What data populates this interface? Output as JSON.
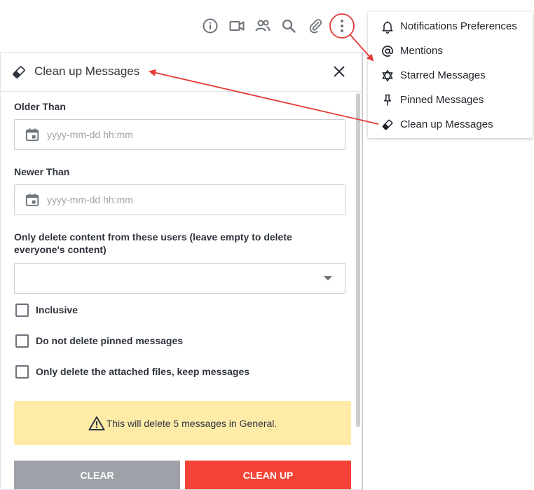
{
  "colors": {
    "accent_red": "#f44336",
    "clear_gray": "#9ea2a8",
    "warning_bg": "#ffeba8",
    "annotation_red": "#e53935"
  },
  "toolbar": {
    "icons": [
      "info-icon",
      "video-icon",
      "members-icon",
      "search-icon",
      "attachment-icon",
      "kebab-menu-icon"
    ]
  },
  "panel": {
    "title": "Clean up Messages",
    "older_than": {
      "label": "Older Than",
      "placeholder": "yyyy-mm-dd hh:mm"
    },
    "newer_than": {
      "label": "Newer Than",
      "placeholder": "yyyy-mm-dd hh:mm"
    },
    "users": {
      "label_line1": "Only delete content from these users (leave empty to delete",
      "label_line2": "everyone's content)",
      "value": ""
    },
    "checkboxes": {
      "inclusive": "Inclusive",
      "pinned": "Do not delete pinned messages",
      "files_only": "Only delete the attached files, keep messages"
    },
    "warning": "This will delete 5 messages in General.",
    "buttons": {
      "clear": "CLEAR",
      "clean_up": "CLEAN UP"
    }
  },
  "menu": {
    "items": [
      {
        "label": "Notifications Preferences",
        "icon": "bell-icon"
      },
      {
        "label": "Mentions",
        "icon": "at-icon"
      },
      {
        "label": "Starred Messages",
        "icon": "star-of-david-icon"
      },
      {
        "label": "Pinned Messages",
        "icon": "pin-icon"
      },
      {
        "label": "Clean up Messages",
        "icon": "eraser-icon"
      }
    ]
  }
}
